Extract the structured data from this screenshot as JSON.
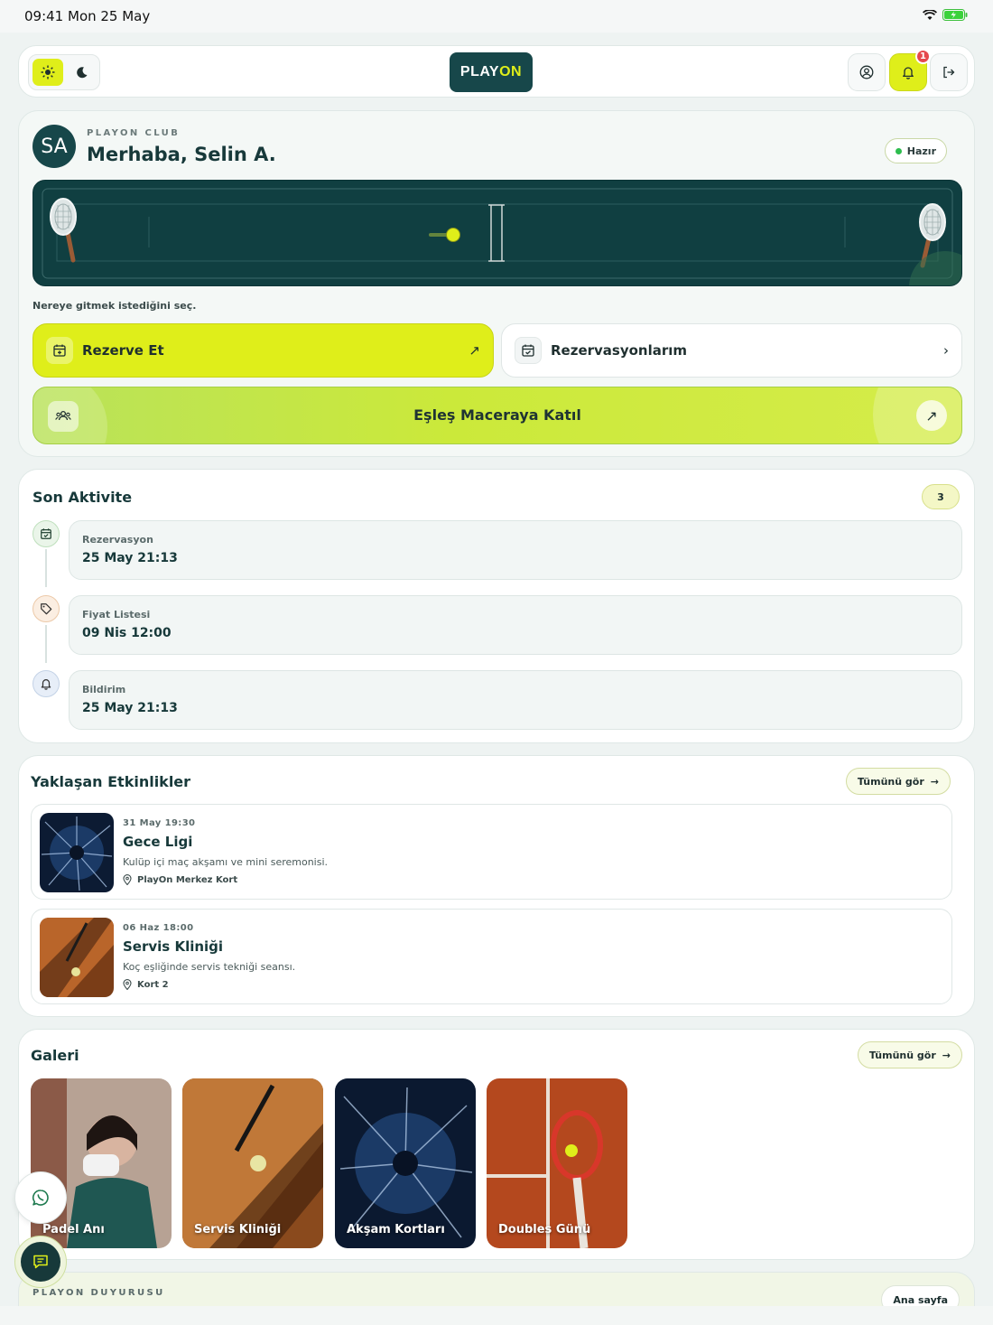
{
  "status_bar": {
    "time": "09:41  Mon 25 May"
  },
  "header": {
    "logo_part1": "PLAY",
    "logo_part2": "ON",
    "notification_count": "1"
  },
  "hero": {
    "avatar_initials": "SA",
    "club_label": "PLAYON CLUB",
    "greeting": "Merhaba, Selin A.",
    "status": "Hazır",
    "hint": "Nereye gitmek istediğini seç.",
    "reserve_label": "Rezerve Et",
    "my_reservations_label": "Rezervasyonlarım",
    "match_label": "Eşleş Maceraya Katıl"
  },
  "activity": {
    "title": "Son Aktivite",
    "count": "3",
    "items": [
      {
        "type": "Rezervasyon",
        "date": "25 May 21:13",
        "icon": "calendar-check-icon"
      },
      {
        "type": "Fiyat Listesi",
        "date": "09 Nis 12:00",
        "icon": "tag-icon"
      },
      {
        "type": "Bildirim",
        "date": "25 May 21:13",
        "icon": "bell-icon"
      }
    ]
  },
  "events": {
    "title": "Yaklaşan Etkinlikler",
    "see_all": "Tümünü gör",
    "items": [
      {
        "when": "31 May 19:30",
        "title": "Gece Ligi",
        "desc": "Kulüp içi maç akşamı ve mini seremonisi.",
        "location": "PlayOn Merkez Kort"
      },
      {
        "when": "06 Haz 18:00",
        "title": "Servis Kliniği",
        "desc": "Koç eşliğinde servis tekniği seansı.",
        "location": "Kort 2"
      }
    ]
  },
  "gallery": {
    "title": "Galeri",
    "see_all": "Tümünü gör",
    "items": [
      {
        "label": "Padel Anı"
      },
      {
        "label": "Servis Kliniği"
      },
      {
        "label": "Akşam Kortları"
      },
      {
        "label": "Doubles Günü"
      }
    ]
  },
  "announcement": {
    "label": "PLAYON DUYURUSU",
    "home_button": "Ana sayfa"
  },
  "colors": {
    "brand_dark": "#17474a",
    "accent_lime": "#dfee1a",
    "badge_red": "#e5484d"
  }
}
